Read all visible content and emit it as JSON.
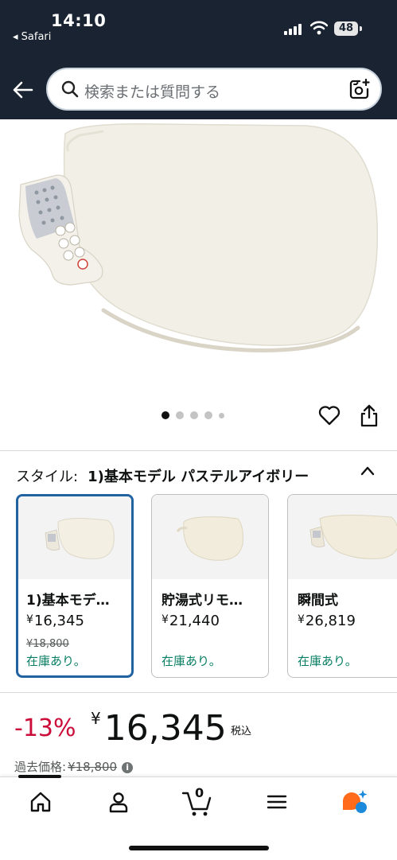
{
  "status_bar": {
    "time": "14:10",
    "back_app": "◂ Safari",
    "battery": "48"
  },
  "search": {
    "placeholder": "検索または質問する"
  },
  "carousel": {
    "pages": 5,
    "active": 0
  },
  "style": {
    "label": "スタイル:",
    "selected": "1)基本モデル パステルアイボリー",
    "options": [
      {
        "title": "1)基本モデ…",
        "price": "16,345",
        "old_price": "¥18,800",
        "stock": "在庫あり。"
      },
      {
        "title": "貯湯式リモ…",
        "price": "21,440",
        "stock": "在庫あり。"
      },
      {
        "title": "瞬間式",
        "price": "26,819",
        "stock": "在庫あり。"
      }
    ]
  },
  "price": {
    "discount": "-13%",
    "currency": "¥",
    "value": "16,345",
    "tax": "税込",
    "past_label": "過去価格:",
    "past_value": "¥18,800"
  },
  "bottom_nav": {
    "cart_count": "0"
  },
  "colors": {
    "header_bg": "#1a2331",
    "selected_border": "#2162a1",
    "discount": "#cc0c39",
    "in_stock": "#067d62",
    "assistant_orange": "#ff6b1a",
    "assistant_blue": "#1c8adb"
  },
  "icons": [
    "back-arrow-icon",
    "search-icon",
    "camera-icon",
    "heart-icon",
    "share-icon",
    "chevron-up-icon",
    "info-icon",
    "home-icon",
    "account-icon",
    "cart-icon",
    "menu-icon",
    "rufus-icon"
  ]
}
